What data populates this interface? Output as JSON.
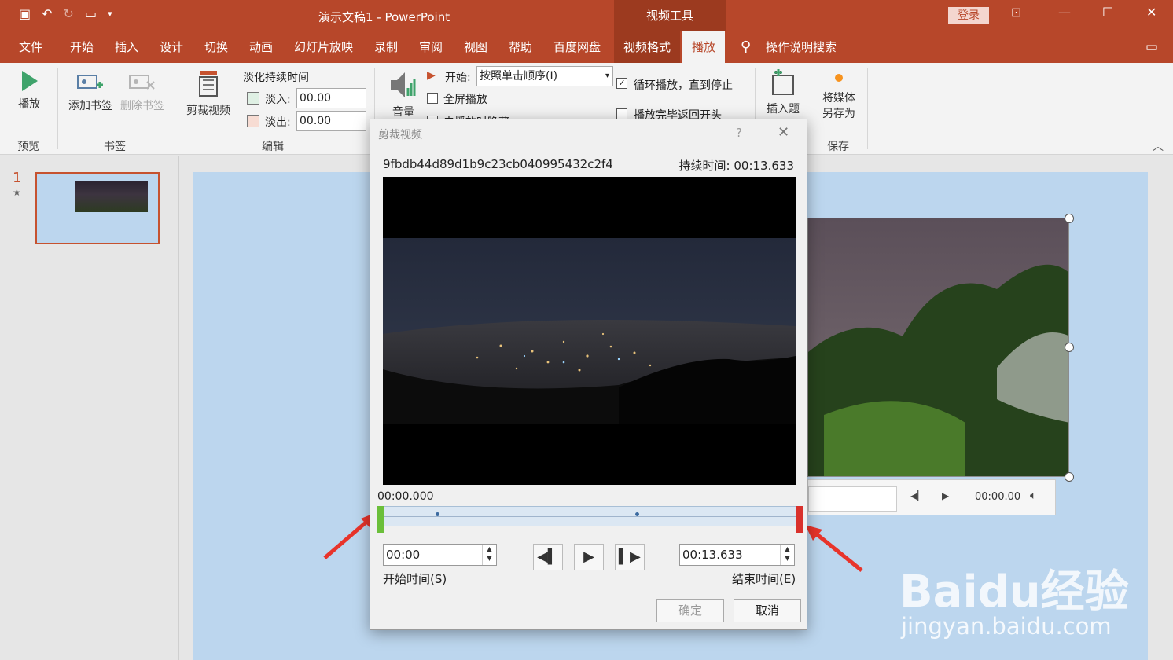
{
  "window": {
    "title": "演示文稿1  -  PowerPoint",
    "context_tab_title": "视频工具",
    "login_label": "登录"
  },
  "tabs": [
    "文件",
    "开始",
    "插入",
    "设计",
    "切换",
    "动画",
    "幻灯片放映",
    "录制",
    "审阅",
    "视图",
    "帮助",
    "百度网盘",
    "视频格式",
    "播放",
    "操作说明搜索"
  ],
  "ribbon": {
    "preview": {
      "play_label": "播放",
      "group_label": "预览"
    },
    "bookmarks": {
      "add_label": "添加书签",
      "remove_label": "删除书签",
      "group_label": "书签"
    },
    "editing": {
      "trim_label": "剪裁视频",
      "fade_title": "淡化持续时间",
      "fade_in_label": "淡入:",
      "fade_in_value": "00.00",
      "fade_out_label": "淡出:",
      "fade_out_value": "00.00",
      "group_label": "编辑"
    },
    "video_options": {
      "volume_label": "音量",
      "start_label": "开始:",
      "start_value": "按照单击顺序(I)",
      "fullscreen_label": "全屏播放",
      "loop_label": "循环播放，直到停止",
      "loop_checked": true,
      "rewind_label": "播放完毕返回开头",
      "hide_label": "未播放时隐藏"
    },
    "captions": {
      "insert_label": "插入题"
    },
    "save": {
      "save_as_label": "将媒体另存为",
      "group_label": "保存"
    }
  },
  "slide_panel": {
    "slide_number": "1"
  },
  "slide": {
    "player_time": "00:00.00"
  },
  "dialog": {
    "title": "剪裁视频",
    "help": "?",
    "filename": "9fbdb44d89d1b9c23cb040995432c2f4",
    "duration": "持续时间: 00:13.633",
    "current_time": "00:00.000",
    "start_time_value": "00:00",
    "end_time_value": "00:13.633",
    "start_time_label": "开始时间(S)",
    "end_time_label": "结束时间(E)",
    "ok_label": "确定",
    "cancel_label": "取消"
  },
  "watermark": {
    "brand": "Baidu经验",
    "url": "jingyan.baidu.com"
  },
  "colors": {
    "accent": "#b7472a",
    "accent_dark": "#9c3a1f",
    "slide_bg": "#bcd6ee",
    "trim_start": "#6bbf3a",
    "trim_end": "#d9312c"
  }
}
